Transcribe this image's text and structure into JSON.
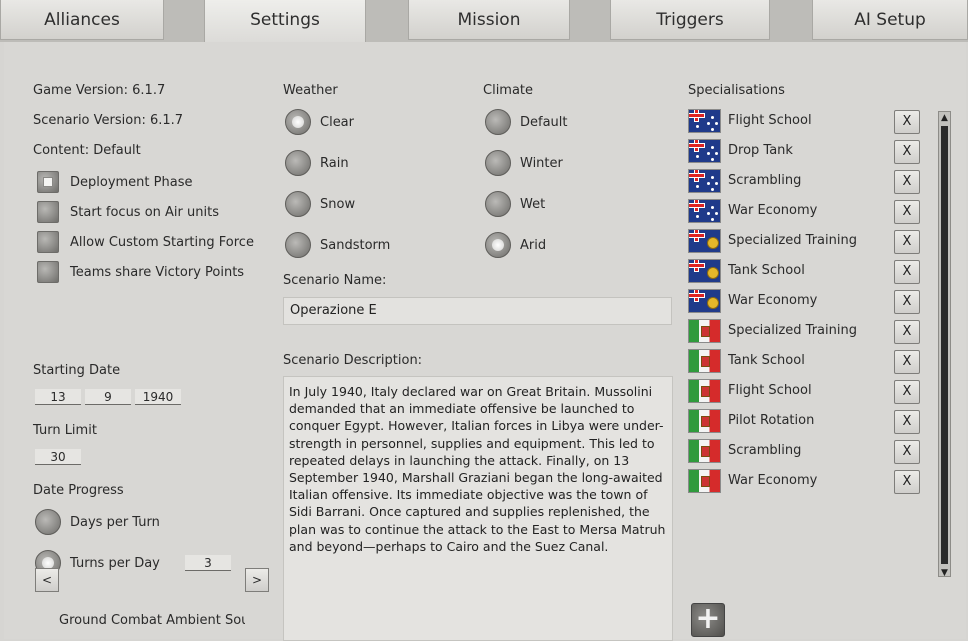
{
  "tabs": [
    {
      "label": "Alliances"
    },
    {
      "label": "Settings"
    },
    {
      "label": "Mission"
    },
    {
      "label": "Triggers"
    },
    {
      "label": "AI Setup"
    }
  ],
  "active_tab": "Settings",
  "left": {
    "game_version": "Game Version: 6.1.7",
    "scenario_version": "Scenario Version: 6.1.7",
    "content": "Content: Default",
    "options": [
      {
        "label": "Deployment Phase",
        "checked": true
      },
      {
        "label": "Start focus on Air units",
        "checked": false
      },
      {
        "label": "Allow Custom Starting Force",
        "checked": false
      },
      {
        "label": "Teams share Victory Points",
        "checked": false
      }
    ],
    "starting_date_label": "Starting Date",
    "date": {
      "day": "13",
      "month": "9",
      "year": "1940"
    },
    "turn_limit_label": "Turn Limit",
    "turn_limit": "30",
    "date_progress_label": "Date Progress",
    "progress_options": [
      {
        "label": "Days per Turn",
        "checked": false
      },
      {
        "label": "Turns per Day",
        "checked": true
      }
    ],
    "turns_per_day": "3",
    "ambient_sound": "Ground Combat Ambient Sound",
    "prev": "<",
    "next": ">"
  },
  "weather": {
    "label": "Weather",
    "options": [
      {
        "label": "Clear",
        "checked": true
      },
      {
        "label": "Rain",
        "checked": false
      },
      {
        "label": "Snow",
        "checked": false
      },
      {
        "label": "Sandstorm",
        "checked": false
      }
    ]
  },
  "climate": {
    "label": "Climate",
    "options": [
      {
        "label": "Default",
        "checked": false
      },
      {
        "label": "Winter",
        "checked": false
      },
      {
        "label": "Wet",
        "checked": false
      },
      {
        "label": "Arid",
        "checked": true
      }
    ]
  },
  "scenario": {
    "name_label": "Scenario Name:",
    "name": "Operazione E",
    "description_label": "Scenario Description:",
    "description": "In July 1940, Italy declared war on Great Britain.  Mussolini demanded that an immediate offensive be launched to conquer Egypt.  However, Italian forces in Libya were under-strength in personnel, supplies and equipment. This led to repeated delays in launching the attack.  Finally, on 13 September 1940, Marshall Graziani began the long-awaited Italian offensive.  Its immediate objective was the town of Sidi Barrani.  Once captured and supplies replenished, the plan was to continue the attack to the East to Mersa Matruh and beyond—perhaps to Cairo and the Suez Canal."
  },
  "specialisations": {
    "label": "Specialisations",
    "remove_label": "X",
    "add_label": "+",
    "items": [
      {
        "flag": "australia-flag-icon",
        "name": "Flight School"
      },
      {
        "flag": "australia-flag-icon",
        "name": "Drop Tank"
      },
      {
        "flag": "australia-flag-icon",
        "name": "Scrambling"
      },
      {
        "flag": "australia-flag-icon",
        "name": "War Economy"
      },
      {
        "flag": "india-flag-icon",
        "name": "Specialized Training"
      },
      {
        "flag": "india-flag-icon",
        "name": "Tank School"
      },
      {
        "flag": "india-flag-icon",
        "name": "War Economy"
      },
      {
        "flag": "italy-flag-icon",
        "name": "Specialized Training"
      },
      {
        "flag": "italy-flag-icon",
        "name": "Tank School"
      },
      {
        "flag": "italy-flag-icon",
        "name": "Flight School"
      },
      {
        "flag": "italy-flag-icon",
        "name": "Pilot Rotation"
      },
      {
        "flag": "italy-flag-icon",
        "name": "Scrambling"
      },
      {
        "flag": "italy-flag-icon",
        "name": "War Economy"
      }
    ]
  }
}
